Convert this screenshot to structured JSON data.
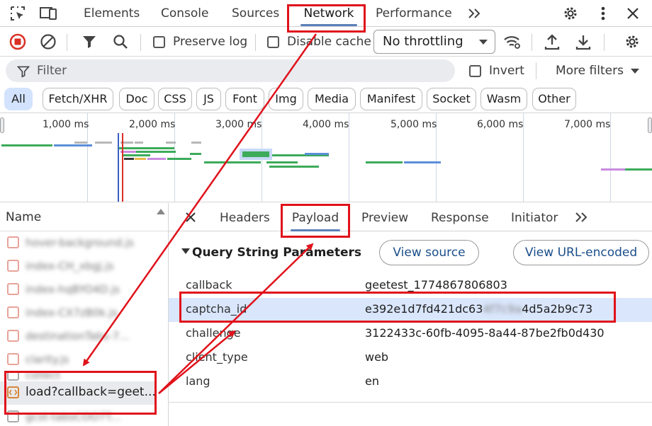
{
  "tabs": [
    "Elements",
    "Console",
    "Sources",
    "Network",
    "Performance"
  ],
  "active_tab": "Network",
  "toolbar": {
    "preserve_log": "Preserve log",
    "disable_cache": "Disable cache",
    "throttling": "No throttling"
  },
  "filter": {
    "placeholder": "Filter",
    "invert": "Invert",
    "more_filters": "More filters"
  },
  "type_chips": [
    "All",
    "Fetch/XHR",
    "Doc",
    "CSS",
    "JS",
    "Font",
    "Img",
    "Media",
    "Manifest",
    "Socket",
    "Wasm",
    "Other"
  ],
  "timeline": {
    "ticks": [
      "1,000 ms",
      "2,000 ms",
      "3,000 ms",
      "4,000 ms",
      "5,000 ms",
      "6,000 ms",
      "7,000 ms"
    ]
  },
  "request_list": {
    "header": "Name",
    "blurred_items": [
      "hover-background.js",
      "index-CH_xbgj.js",
      "index-hqBYO4D.js",
      "index-CX7zB0k.js",
      "destinationTabs-7...",
      "clarity.js",
      "collect"
    ],
    "selected_item": "load?callback=geet...",
    "blurred_after": "gcst-tabsCOO7T..."
  },
  "details": {
    "subtabs": [
      "Headers",
      "Payload",
      "Preview",
      "Response",
      "Initiator"
    ],
    "active_subtab": "Payload",
    "section_title": "Query String Parameters",
    "view_source": "View source",
    "view_url_encoded": "View URL-encoded",
    "params": [
      {
        "key": "callback",
        "value": "geetest_1774867806803"
      },
      {
        "key": "captcha_id",
        "value_start": "e392e1d7fd421dc63",
        "value_hidden": "4f7c9a",
        "value_end": "4d5a2b9c73"
      },
      {
        "key": "challenge",
        "value": "3122433c-60fb-4095-8a44-87be2fb0d430"
      },
      {
        "key": "client_type",
        "value": "web"
      },
      {
        "key": "lang",
        "value": "en"
      }
    ]
  },
  "colors": {
    "annotation": "#e0121b",
    "accent": "#5b7fb8",
    "highlight_row": "#d9e6fb",
    "active_chip": "#d3e3fd"
  }
}
